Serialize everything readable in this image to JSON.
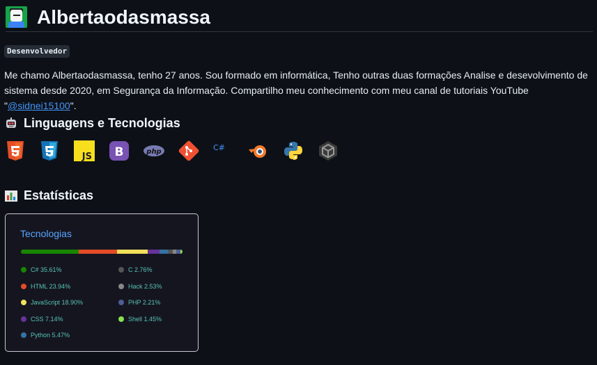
{
  "header": {
    "title": "Albertaodasmassa"
  },
  "profile": {
    "role": "Desenvolvedor",
    "bio_text": "Me chamo Albertaodasmassa, tenho 27 anos. Sou formado em informática, Tenho outras duas formações Analise e desevolvimento de sistema desde 2020, em Segurança da Informação. Compartilho meu conhecimento com meu canal de tutoriais YouTube \"",
    "bio_link": "@sidnei15100",
    "bio_end": "\"."
  },
  "sections": {
    "tech_heading": "Linguagens e Tecnologias",
    "stats_heading": "Estatísticas"
  },
  "tech_icons": [
    {
      "name": "html5-icon",
      "color": "#e34f26"
    },
    {
      "name": "css3-icon",
      "color": "#1572b6"
    },
    {
      "name": "javascript-icon",
      "color": "#f7df1e",
      "label": "JS"
    },
    {
      "name": "bootstrap-icon",
      "color": "#7952b3",
      "label": "B"
    },
    {
      "name": "php-icon",
      "color": "#777bb3",
      "label": "php"
    },
    {
      "name": "git-icon",
      "color": "#f05032"
    },
    {
      "name": "csharp-icon",
      "color": "#2b7bd6",
      "label": "C#"
    },
    {
      "name": "blender-icon",
      "color": "#f5792a"
    },
    {
      "name": "python-icon",
      "color": "#3776ab"
    },
    {
      "name": "unity-icon",
      "color": "#888888"
    }
  ],
  "stats_card": {
    "title": "Tecnologias",
    "languages": [
      {
        "name": "C#",
        "percent": 35.61,
        "label": "C# 35.61%",
        "color": "#178600"
      },
      {
        "name": "HTML",
        "percent": 23.94,
        "label": "HTML 23.94%",
        "color": "#e34c26"
      },
      {
        "name": "JavaScript",
        "percent": 18.9,
        "label": "JavaScript 18.90%",
        "color": "#f1e05a"
      },
      {
        "name": "CSS",
        "percent": 7.14,
        "label": "CSS 7.14%",
        "color": "#663399"
      },
      {
        "name": "Python",
        "percent": 5.47,
        "label": "Python 5.47%",
        "color": "#3572a5"
      },
      {
        "name": "C",
        "percent": 2.76,
        "label": "C 2.76%",
        "color": "#555555"
      },
      {
        "name": "Hack",
        "percent": 2.53,
        "label": "Hack 2.53%",
        "color": "#878787"
      },
      {
        "name": "PHP",
        "percent": 2.21,
        "label": "PHP 2.21%",
        "color": "#4f5d95"
      },
      {
        "name": "Shell",
        "percent": 1.45,
        "label": "Shell 1.45%",
        "color": "#89e051"
      }
    ]
  }
}
